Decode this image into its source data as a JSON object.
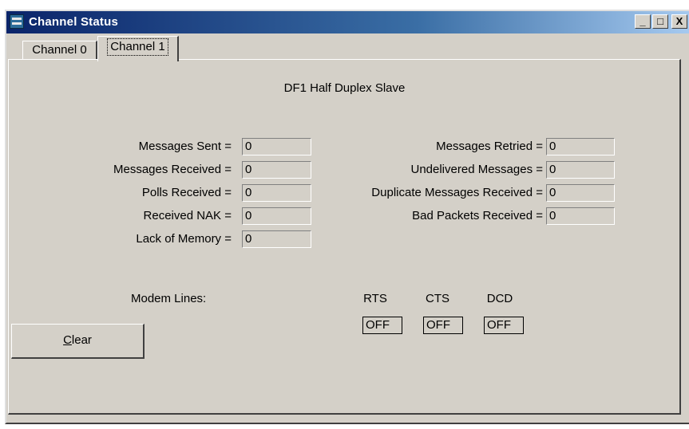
{
  "window": {
    "title": "Channel Status",
    "min_label": "_",
    "max_label": "□",
    "close_label": "X"
  },
  "tabs": [
    {
      "label": "Channel 0",
      "active": false
    },
    {
      "label": "Channel 1",
      "active": true
    }
  ],
  "panel": {
    "heading": "DF1 Half Duplex Slave",
    "left_fields": [
      {
        "label": "Messages Sent =",
        "value": "0"
      },
      {
        "label": "Messages Received =",
        "value": "0"
      },
      {
        "label": "Polls Received =",
        "value": "0"
      },
      {
        "label": "Received NAK =",
        "value": "0"
      },
      {
        "label": "Lack of Memory =",
        "value": "0"
      }
    ],
    "right_fields": [
      {
        "label": "Messages Retried =",
        "value": "0"
      },
      {
        "label": "Undelivered Messages =",
        "value": "0"
      },
      {
        "label": "Duplicate Messages Received =",
        "value": "0"
      },
      {
        "label": "Bad Packets Received =",
        "value": "0"
      }
    ],
    "modem": {
      "label": "Modem Lines:",
      "lines": [
        {
          "name": "RTS",
          "value": "OFF"
        },
        {
          "name": "CTS",
          "value": "OFF"
        },
        {
          "name": "DCD",
          "value": "OFF"
        }
      ]
    },
    "clear_button": {
      "underlined": "C",
      "rest": "lear"
    }
  }
}
